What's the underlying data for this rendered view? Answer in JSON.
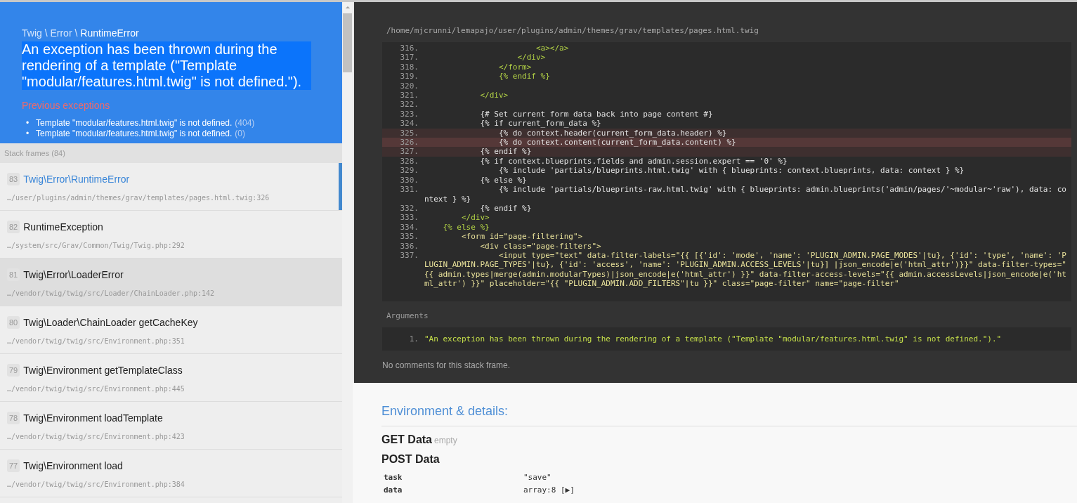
{
  "header": {
    "namespace": "Twig \\ Error \\",
    "class_name": "RuntimeError",
    "message": "An exception has been thrown during the rendering of a template (\"Template \"modular/features.html.twig\" is not defined.\").",
    "previous_title": "Previous exceptions",
    "previous": [
      {
        "marker": "•",
        "text": "Template \"modular/features.html.twig\" is not defined.",
        "code": "(404)"
      },
      {
        "marker": "•",
        "text": "Template \"modular/features.html.twig\" is not defined.",
        "code": "(0)"
      }
    ]
  },
  "frames_title": "Stack frames (84)",
  "frames": [
    {
      "index": "83",
      "name": "Twig\\Error\\RuntimeError",
      "file": "…/user/plugins/admin/themes/grav/templates/pages.html.twig:326",
      "selected": true,
      "hover": false
    },
    {
      "index": "82",
      "name": "RuntimeException",
      "file": "…/system/src/Grav/Common/Twig/Twig.php:292",
      "selected": false,
      "hover": false
    },
    {
      "index": "81",
      "name": "Twig\\Error\\LoaderError",
      "file": "…/vendor/twig/twig/src/Loader/ChainLoader.php:142",
      "selected": false,
      "hover": true
    },
    {
      "index": "80",
      "name": "Twig\\Loader\\ChainLoader getCacheKey",
      "file": "…/vendor/twig/twig/src/Environment.php:351",
      "selected": false,
      "hover": false
    },
    {
      "index": "79",
      "name": "Twig\\Environment getTemplateClass",
      "file": "…/vendor/twig/twig/src/Environment.php:445",
      "selected": false,
      "hover": false
    },
    {
      "index": "78",
      "name": "Twig\\Environment loadTemplate",
      "file": "…/vendor/twig/twig/src/Environment.php:423",
      "selected": false,
      "hover": false
    },
    {
      "index": "77",
      "name": "Twig\\Environment load",
      "file": "…/vendor/twig/twig/src/Environment.php:384",
      "selected": false,
      "hover": false
    }
  ],
  "file_path": "/home/mjcrunni/lemapajo/user/plugins/admin/themes/grav/templates/pages.html.twig",
  "code_lines": [
    {
      "number": "316.",
      "highlighted": false,
      "current": false,
      "kind": "tag",
      "text": "                        <a></a>"
    },
    {
      "number": "317.",
      "highlighted": false,
      "current": false,
      "kind": "tag",
      "text": "                    </div>"
    },
    {
      "number": "318.",
      "highlighted": false,
      "current": false,
      "kind": "tag",
      "text": "                </form>"
    },
    {
      "number": "319.",
      "highlighted": false,
      "current": false,
      "kind": "tag",
      "text": "                {% endif %}"
    },
    {
      "number": "320.",
      "highlighted": false,
      "current": false
    },
    {
      "number": "321.",
      "highlighted": false,
      "current": false,
      "kind": "tag",
      "text": "            </div>"
    },
    {
      "number": "322.",
      "highlighted": false,
      "current": false
    },
    {
      "number": "323.",
      "highlighted": false,
      "current": false,
      "kind": "twig",
      "text": "            {# Set current form data back into page content #}"
    },
    {
      "number": "324.",
      "highlighted": false,
      "current": false,
      "kind": "twig",
      "text": "            {% if current_form_data %}"
    },
    {
      "number": "325.",
      "highlighted": true,
      "current": false,
      "kind": "twig",
      "text": "                {% do context.header(current_form_data.header) %}"
    },
    {
      "number": "326.",
      "highlighted": true,
      "current": true,
      "kind": "twig",
      "text": "                {% do context.content(current_form_data.content) %}"
    },
    {
      "number": "327.",
      "highlighted": true,
      "current": false,
      "kind": "twig",
      "text": "            {% endif %}"
    },
    {
      "number": "328.",
      "highlighted": false,
      "current": false,
      "kind": "twig",
      "text": "            {% if context.blueprints.fields and admin.session.expert == '0' %}"
    },
    {
      "number": "329.",
      "highlighted": false,
      "current": false,
      "kind": "twig",
      "text": "                {% include 'partials/blueprints.html.twig' with { blueprints: context.blueprints, data: context } %}"
    },
    {
      "number": "330.",
      "highlighted": false,
      "current": false,
      "kind": "twig",
      "text": "            {% else %}"
    },
    {
      "number": "331.",
      "highlighted": false,
      "current": false,
      "kind": "twig",
      "text": "                {% include 'partials/blueprints-raw.html.twig' with { blueprints: admin.blueprints('admin/pages/'~modular~'raw'), data: context } %}"
    },
    {
      "number": "332.",
      "highlighted": false,
      "current": false,
      "kind": "twig",
      "text": "            {% endif %}"
    },
    {
      "number": "333.",
      "highlighted": false,
      "current": false,
      "kind": "tag",
      "text": "        </div>"
    },
    {
      "number": "334.",
      "highlighted": false,
      "current": false,
      "kind": "tag",
      "text": "    {% else %}"
    },
    {
      "number": "335.",
      "highlighted": false,
      "current": false,
      "kind": "markup",
      "text": "        <form id=\"page-filtering\">"
    },
    {
      "number": "336.",
      "highlighted": false,
      "current": false,
      "kind": "markup",
      "text": "            <div class=\"page-filters\">"
    },
    {
      "number": "337.",
      "highlighted": false,
      "current": false,
      "kind": "markup",
      "text": "                <input type=\"text\" data-filter-labels=\"{{ [{'id': 'mode', 'name': 'PLUGIN_ADMIN.PAGE_MODES'|tu}, {'id': 'type', 'name': 'PLUGIN_ADMIN.PAGE_TYPES'|tu}, {'id': 'access', 'name': 'PLUGIN_ADMIN.ACCESS_LEVELS'|tu}] |json_encode|e('html_attr')}}\" data-filter-types=\"{{ admin.types|merge(admin.modularTypes)|json_encode|e('html_attr') }}\" data-filter-access-levels=\"{{ admin.accessLevels|json_encode|e('html_attr') }}\" placeholder=\"{{ \"PLUGIN_ADMIN.ADD_FILTERS\"|tu }}\" class=\"page-filter\" name=\"page-filter\""
    }
  ],
  "arguments_title": "Arguments",
  "arguments": [
    {
      "number": "1.",
      "value": "\"An exception has been thrown during the rendering of a template (\"Template \"modular/features.html.twig\" is not defined.\").\""
    }
  ],
  "frame_comments": "No comments for this stack frame.",
  "details": {
    "title": "Environment & details:",
    "sections": [
      {
        "title": "GET Data",
        "note": "empty"
      },
      {
        "title": "POST Data",
        "rows": [
          {
            "key": "task",
            "value": "\"save\""
          },
          {
            "key": "data",
            "value": "array:8 [▶]"
          }
        ]
      }
    ]
  }
}
